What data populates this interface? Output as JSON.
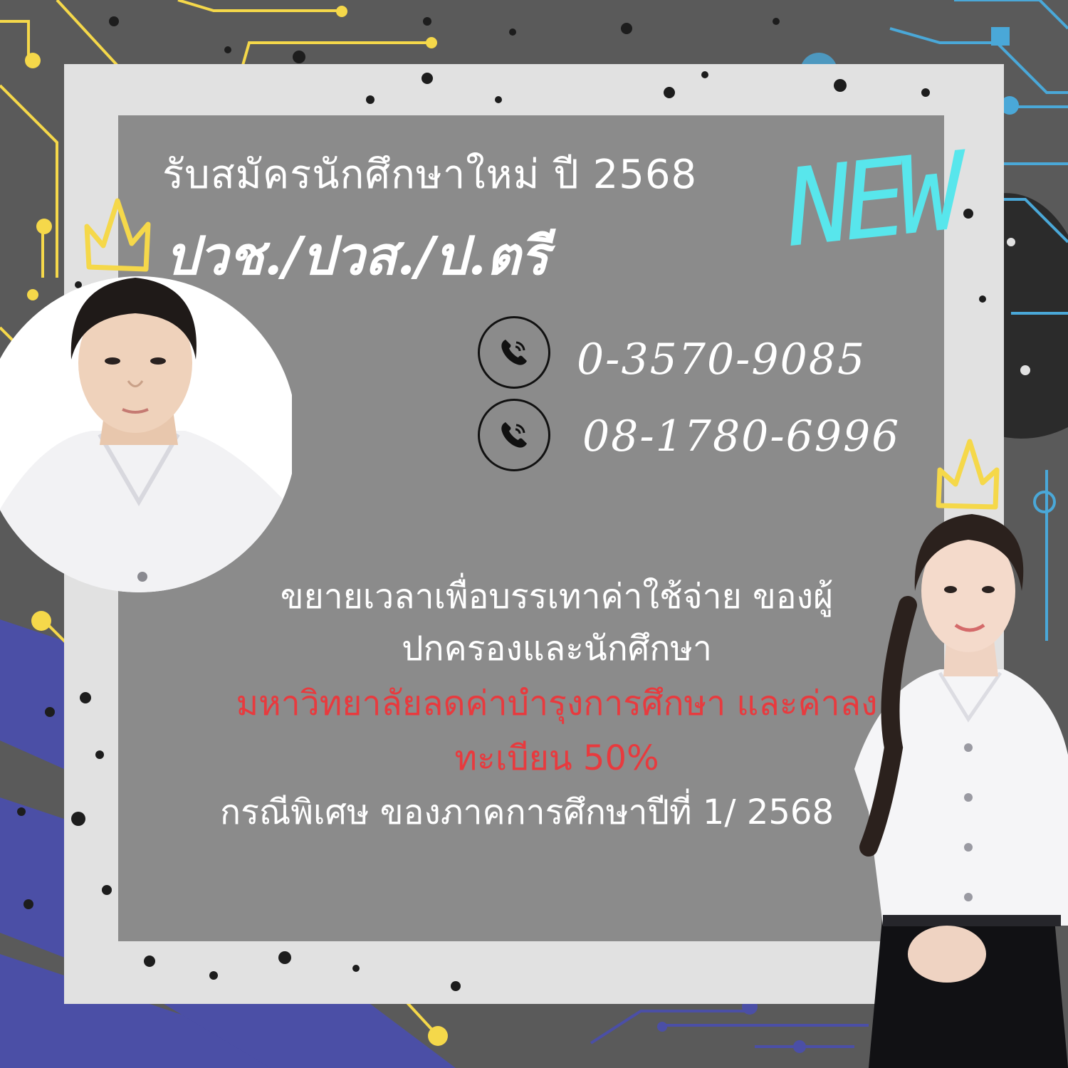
{
  "poster": {
    "headline": "รับสมัครนักศึกษาใหม่ ปี 2568",
    "programs": "ปวช./ปวส./ป.ตรี",
    "badge": "NEW",
    "phones": [
      "0-3570-9085",
      "08-1780-6996"
    ],
    "notice_lines": [
      "ขยายเวลาเพื่อบรรเทาค่าใช้จ่าย ของผู้",
      "ปกครองและนักศึกษา",
      "มหาวิทยาลัยลดค่าบำรุงการศึกษา และค่าลง",
      "ทะเบียน 50%",
      "กรณีพิเศษ ของภาคการศึกษาปีที่ 1/ 2568"
    ]
  },
  "colors": {
    "background": "#5a5a5a",
    "frame": "#e1e1e1",
    "panel": "#8b8b8b",
    "accent_red": "#e83a3e",
    "accent_cyan": "#58e6ec",
    "circuit_yellow": "#f5d84a",
    "circuit_blue": "#4aa8d8",
    "circuit_indigo": "#4b4fa6"
  },
  "icons": [
    "phone-icon",
    "phone-icon",
    "crown-icon",
    "crown-icon"
  ]
}
